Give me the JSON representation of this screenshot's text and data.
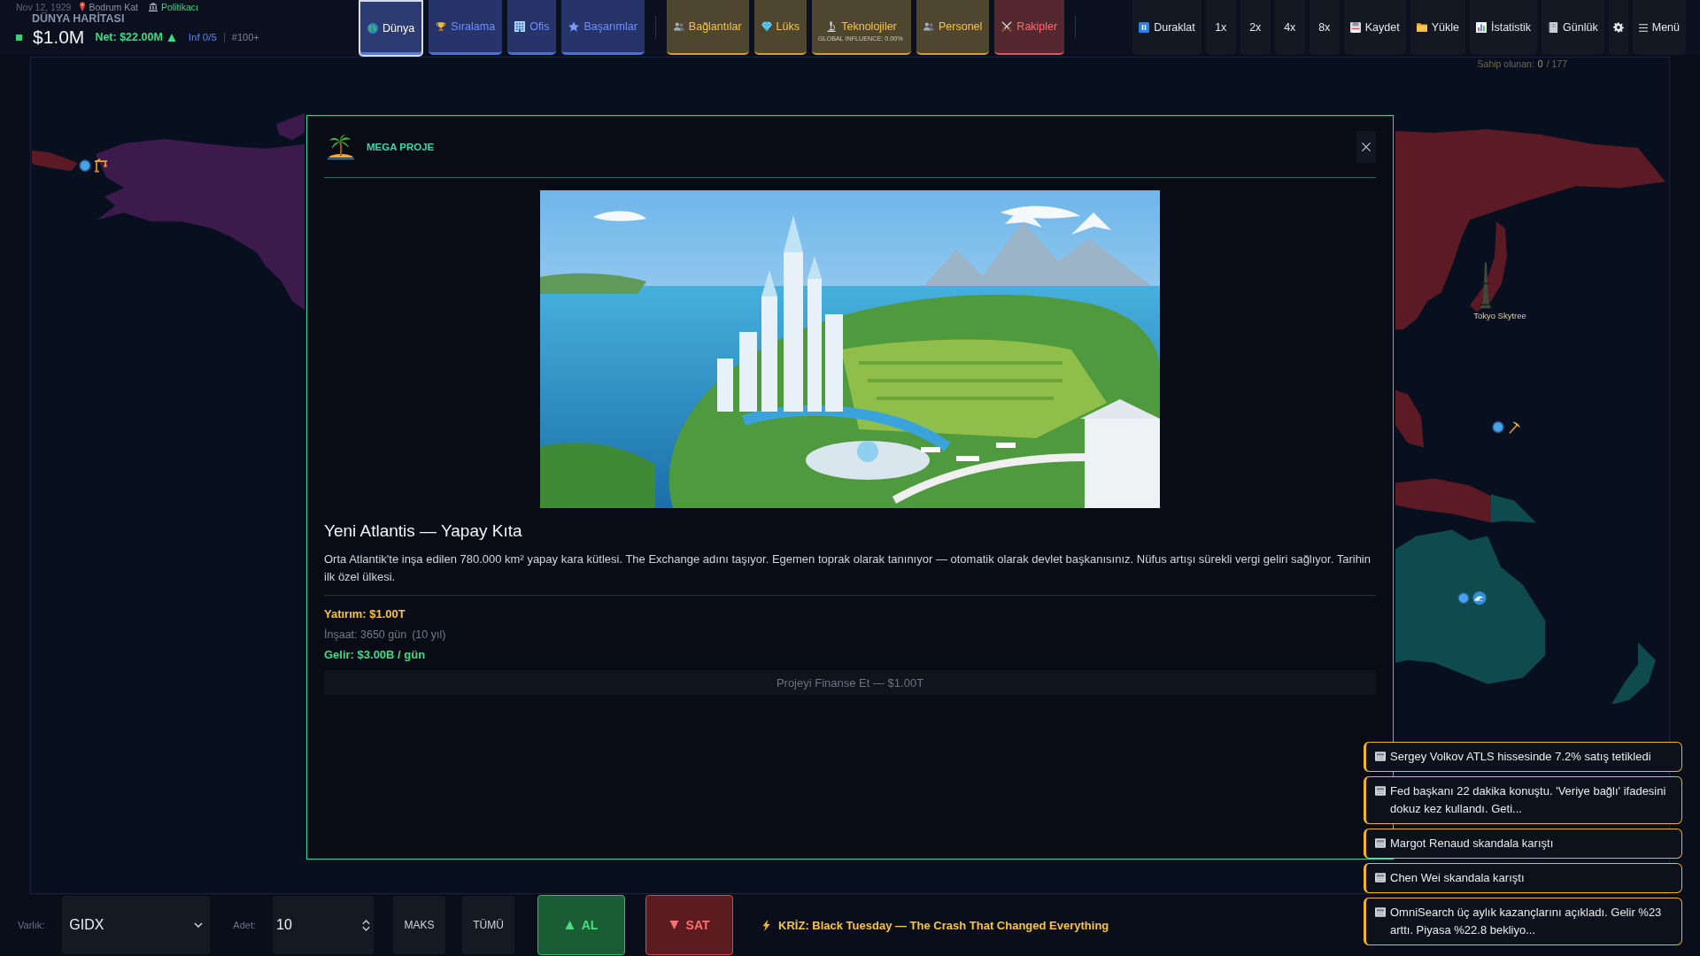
{
  "status": {
    "date": "Nov 12, 1929",
    "location": "Bodrum Kat",
    "role": "Politikacı",
    "view_title": "DÜNYA HARİTASI",
    "cash": "$1.0M",
    "net": "Net: $22.00M",
    "influence": "Inf 0/5",
    "rank": "#100+"
  },
  "nav_tabs": [
    {
      "label": "Dünya",
      "selected": true
    },
    {
      "label": "Sıralama",
      "selected": false
    },
    {
      "label": "Ofis",
      "selected": false
    },
    {
      "label": "Başarımlar",
      "selected": false
    }
  ],
  "panel_buttons": [
    {
      "label": "Bağlantılar",
      "kind": "standard"
    },
    {
      "label": "Lüks",
      "kind": "standard"
    },
    {
      "label": "Teknolojiler",
      "kind": "standard",
      "readout": "GLOBAL INFLUENCE: 0.00%"
    },
    {
      "label": "Personel",
      "kind": "standard"
    },
    {
      "label": "Rakipler",
      "kind": "danger"
    }
  ],
  "controls": [
    "Duraklat",
    "1x",
    "2x",
    "4x",
    "8x",
    "Kaydet",
    "Yükle",
    "İstatistik",
    "Günlük"
  ],
  "menu": "Menü",
  "owned": {
    "label": "Sahip olunan:",
    "count": "0",
    "total": "/ 177"
  },
  "map": {
    "labels": [
      "Tokyo Skytree"
    ],
    "markers": [
      {
        "kind": "crane"
      },
      {
        "kind": "pickaxe"
      },
      {
        "kind": "wave"
      }
    ]
  },
  "modal": {
    "category": "MEGA PROJE",
    "title": "Yeni Atlantis — Yapay Kıta",
    "description": "Orta Atlantik'te inşa edilen 780.000 km² yapay kara kütlesi. The Exchange adını taşıyor. Egemen toprak olarak tanınıyor — otomatik olarak devlet başkanısınız. Nüfus artışı sürekli vergi geliri sağlıyor. Tarihin ilk özel ülkesi.",
    "investment": "Yatırım: $1.00T",
    "construction": "İnşaat: 3650 gün",
    "construction_years": "(10 yıl)",
    "income": "Gelir: $3.00B / gün",
    "fund_button": {
      "label": "Projeyi Finanse Et — $1.00T",
      "disabled": true
    }
  },
  "notifications": [
    "Sergey Volkov ATLS hissesinde 7.2% satış tetikledi",
    "Fed başkanı 22 dakika konuştu. 'Veriye bağlı' ifadesini dokuz kez kullandı. Geti...",
    "Margot Renaud skandala karıştı",
    "Chen Wei skandala karıştı",
    "OmniSearch üç aylık kazançlarını açıkladı. Gelir %23 arttı. Piyasa %22.8 bekliyo..."
  ],
  "trade": {
    "asset_label": "Varlık:",
    "asset": "GIDX",
    "quantity_label": "Adet:",
    "quantity": "10",
    "max_button": "MAKS",
    "all_button": "TÜMÜ",
    "buy_button": "AL",
    "sell_button": "SAT"
  },
  "crisis": "KRİZ: Black Tuesday — The Crash That Changed Everything"
}
